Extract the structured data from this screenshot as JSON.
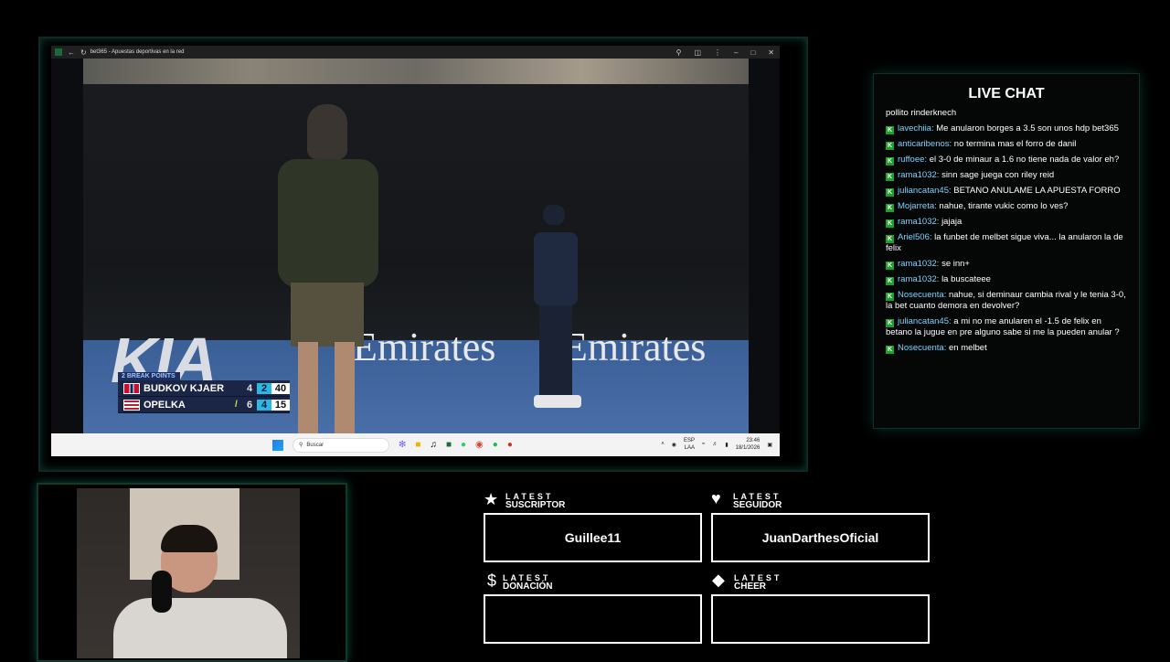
{
  "browser": {
    "title": "bet365 - Apuestas deportivas en la red",
    "back_icon": "arrow-left-icon",
    "reload_icon": "reload-icon",
    "controls": [
      "zoom-icon",
      "extensions-icon",
      "menu-icon",
      "minimize-icon",
      "maximize-icon",
      "close-icon"
    ]
  },
  "video": {
    "ad_left": "KIA",
    "ad_center": "Emirates",
    "ad_right": "Emirates"
  },
  "scoreboard": {
    "header": "2 BREAK POINTS",
    "players": [
      {
        "name": "BUDKOV KJAER",
        "flag": "norway-flag-icon",
        "set": "4",
        "current_game": "2",
        "points": "40",
        "serving": ""
      },
      {
        "name": "OPELKA",
        "flag": "usa-flag-icon",
        "set": "6",
        "current_game": "4",
        "points": "15",
        "serving": "/"
      }
    ]
  },
  "taskbar": {
    "search_placeholder": "Buscar",
    "lang_top": "ESP",
    "lang_bottom": "LAA",
    "time": "23:46",
    "date": "18/1/2026"
  },
  "chat": {
    "title": "LIVE CHAT",
    "first_line": "pollito rinderknech",
    "messages": [
      {
        "user": "lavechiia",
        "text": "Me anularon borges a 3.5 son unos hdp bet365"
      },
      {
        "user": "anticaribenos",
        "text": "no termina mas el forro de danil"
      },
      {
        "user": "ruffoee",
        "text": "el 3-0 de minaur a 1.6 no tiene nada de valor eh?"
      },
      {
        "user": "rama1032",
        "text": "sinn sage juega con riley reid"
      },
      {
        "user": "juliancatan45",
        "text": "BETANO ANULAME LA APUESTA FORRO"
      },
      {
        "user": "Mojarreta",
        "text": "nahue, tirante vukic como lo ves?"
      },
      {
        "user": "rama1032",
        "text": "jajaja"
      },
      {
        "user": "Ariel506",
        "text": "la funbet de melbet sigue viva... la anularon la de felix"
      },
      {
        "user": "rama1032",
        "text": "se inn+"
      },
      {
        "user": "rama1032",
        "text": "la buscateee"
      },
      {
        "user": "Nosecuenta",
        "text": "nahue, si deminaur cambia rival y le tenia 3-0, la bet cuanto demora en devolver?"
      },
      {
        "user": "juliancatan45",
        "text": "a mi no me anularen el -1.5 de felix en betano la jugue en pre alguno sabe si me la pueden anular ?"
      },
      {
        "user": "Nosecuenta",
        "text": "en melbet"
      }
    ]
  },
  "widgets": {
    "subscriber": {
      "label_top": "LATEST",
      "label_bottom": "SUSCRIPTOR",
      "icon": "star-icon",
      "value": "Guillee11"
    },
    "follower": {
      "label_top": "LATEST",
      "label_bottom": "SEGUIDOR",
      "icon": "heart-icon",
      "value": "JuanDarthesOficial"
    },
    "donation": {
      "label_top": "LATEST",
      "label_bottom": "DONACIÓN",
      "icon": "dollar-icon",
      "value": ""
    },
    "cheer": {
      "label_top": "LATEST",
      "label_bottom": "CHEER",
      "icon": "diamond-icon",
      "value": ""
    }
  }
}
